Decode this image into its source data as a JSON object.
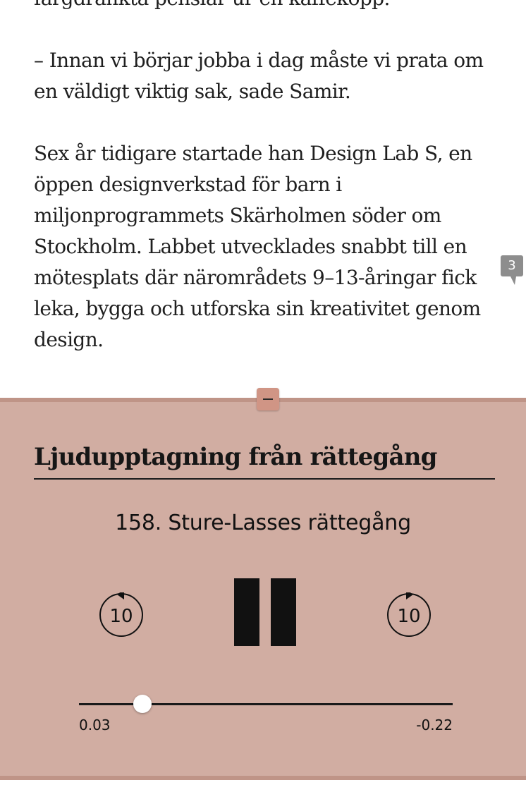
{
  "article": {
    "paragraphs": [
      "färgdränkta penslar ur en kaffekopp.",
      "– Innan vi börjar jobba i dag måste vi prata om en väldigt viktig sak, sade Samir.",
      "Sex år tidigare startade han Design Lab S, en öppen designverkstad för barn i miljonprogrammets Skärholmen söder om Stockholm. Labbet utvecklades snabbt till en mötesplats där närområdets 9–13-åringar fick leka, bygga och utforska sin kreativitet genom design."
    ],
    "comment_count": "3"
  },
  "player": {
    "heading": "Ljudupptagning från rättegång",
    "track_title": "158. Sture-Lasses rättegång",
    "skip_back_label": "10",
    "skip_forward_label": "10",
    "elapsed": "0.03",
    "remaining": "-0.22",
    "progress_fraction": 0.17,
    "background_color": "#d1ada2",
    "accent_color": "#bf9487"
  }
}
